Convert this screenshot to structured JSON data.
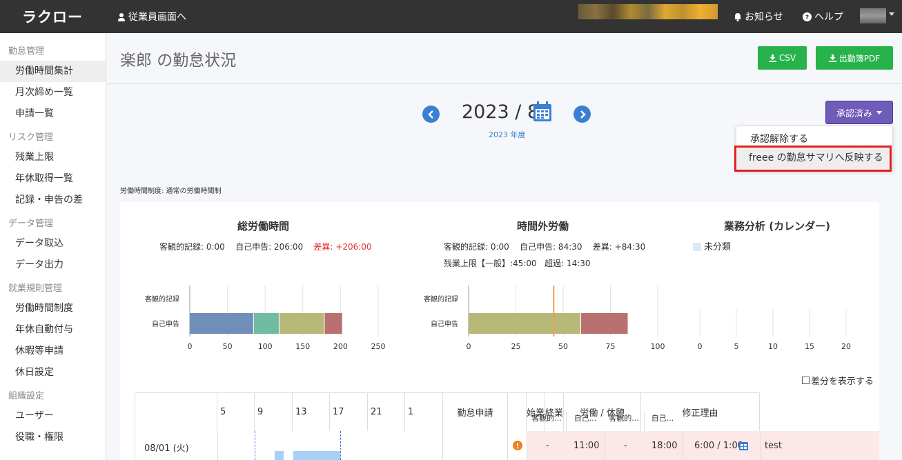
{
  "app": {
    "logo": "ラクロー",
    "employee_link": "従業員画面へ",
    "notice": "お知らせ",
    "help": "ヘルプ"
  },
  "sidebar": [
    {
      "section": "勤怠管理",
      "items": [
        "労働時間集計",
        "月次締め一覧",
        "申請一覧"
      ]
    },
    {
      "section": "リスク管理",
      "items": [
        "残業上限",
        "年休取得一覧",
        "記録・申告の差"
      ]
    },
    {
      "section": "データ管理",
      "items": [
        "データ取込",
        "データ出力"
      ]
    },
    {
      "section": "就業規則管理",
      "items": [
        "労働時間制度",
        "年休自動付与",
        "休暇等申請",
        "休日設定"
      ]
    },
    {
      "section": "組織設定",
      "items": [
        "ユーザー",
        "役職・権限"
      ]
    }
  ],
  "page": {
    "title": "楽郎 の勤怠状況",
    "csv_label": "CSV",
    "pdf_label": "出勤簿PDF",
    "month": "2023 / 8",
    "fiscal_year": "2023 年度",
    "approve_label": "承認済み",
    "dropdown": [
      "承認解除する",
      "freee の勤怠サマリへ反映する"
    ],
    "system_label": "労働時間制度: 通常の労働時間制",
    "show_diff": "差分を表示する"
  },
  "colors": {
    "accent_blue": "#3b7fd1",
    "green": "#27b24b",
    "purple": "#6f5bb8",
    "highlight_red": "#e02020"
  },
  "summary": {
    "total": {
      "title": "総労働時間",
      "objective": "客観的記録: 0:00",
      "self": "自己申告: 206:00",
      "diff": "差異: +206:00"
    },
    "overtime": {
      "title": "時間外労働",
      "objective": "客観的記録: 0:00",
      "self": "自己申告: 84:30",
      "diff": "差異: +84:30",
      "limit": "残業上限【一般】:45:00",
      "over": "超過: 14:30"
    },
    "analysis": {
      "title": "業務分析 (カレンダー)",
      "legend": "未分類"
    }
  },
  "chart_data": [
    {
      "type": "bar",
      "orientation": "horizontal",
      "stacked": true,
      "categories": [
        "客観的記録",
        "自己申告"
      ],
      "series_values": {
        "自己申告": [
          85,
          34,
          60,
          24
        ]
      },
      "colors": [
        "#6f8fb8",
        "#6fbba4",
        "#b8b878",
        "#b87070"
      ],
      "xlim": [
        0,
        250
      ],
      "ticks": [
        0,
        50,
        100,
        150,
        200,
        250
      ]
    },
    {
      "type": "bar",
      "orientation": "horizontal",
      "stacked": true,
      "categories": [
        "客観的記録",
        "自己申告"
      ],
      "series_values": {
        "自己申告": [
          59.5,
          25
        ]
      },
      "colors": [
        "#b8b878",
        "#b87070"
      ],
      "reference_line": 45,
      "xlim": [
        0,
        100
      ],
      "ticks": [
        0,
        25,
        50,
        75,
        100
      ]
    },
    {
      "type": "bar",
      "orientation": "horizontal",
      "categories": [],
      "values": [],
      "xlim": [
        0,
        20
      ],
      "ticks": [
        0,
        5,
        10,
        15,
        20
      ]
    }
  ],
  "table": {
    "timeline_ticks": [
      "5",
      "9",
      "13",
      "17",
      "21",
      "1"
    ],
    "headers": {
      "request": "勤怠申請",
      "start": "始業",
      "end": "終業",
      "work_break": "労働 / 休憩",
      "reason": "修正理由"
    },
    "subheaders": [
      "客観的...",
      "自己..."
    ],
    "rows": [
      {
        "date": "08/01 (火)",
        "start_obj": "-",
        "start_self": "11:00",
        "end_obj": "-",
        "end_self": "18:00",
        "work_break": "6:00 / 1:00",
        "reason": "test"
      }
    ]
  }
}
